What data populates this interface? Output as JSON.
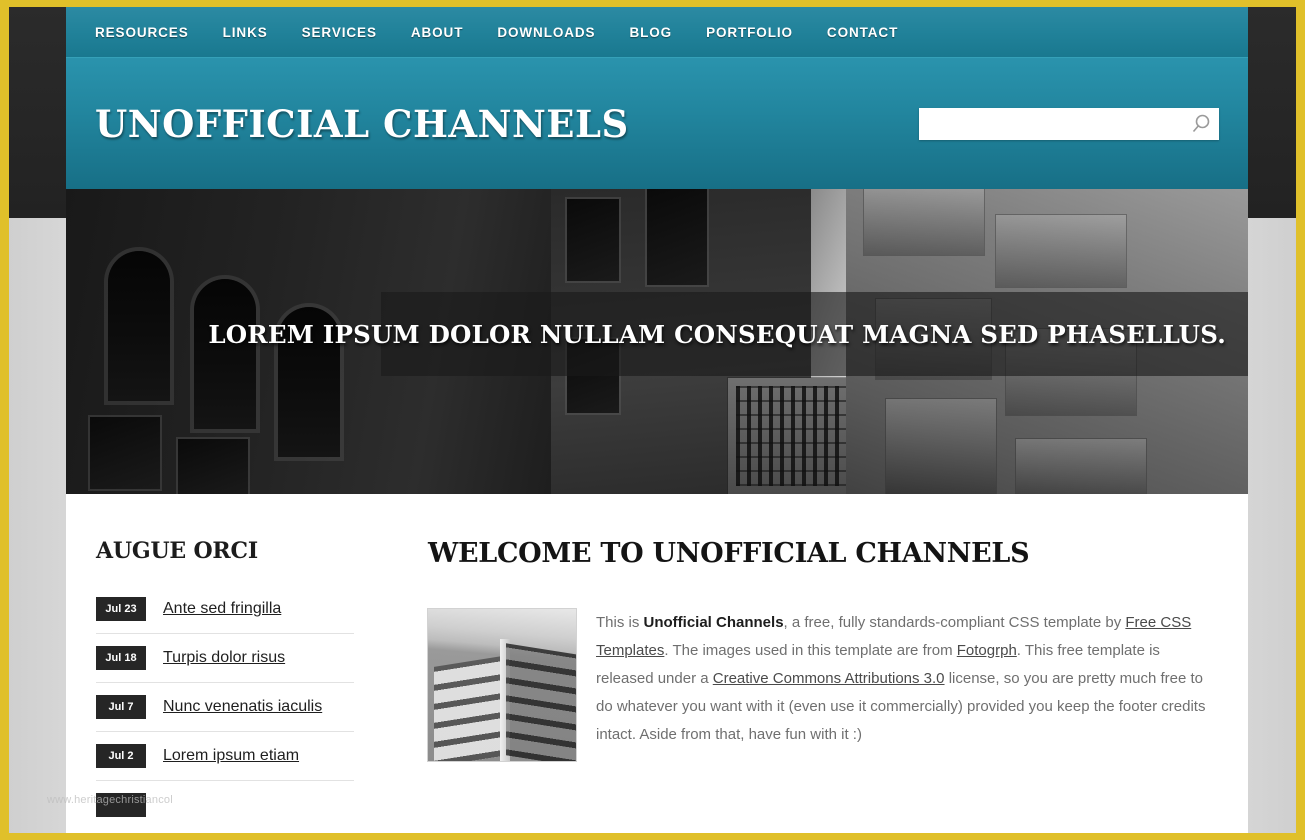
{
  "nav": {
    "items": [
      {
        "label": "RESOURCES"
      },
      {
        "label": "LINKS"
      },
      {
        "label": "SERVICES"
      },
      {
        "label": "ABOUT"
      },
      {
        "label": "DOWNLOADS"
      },
      {
        "label": "BLOG"
      },
      {
        "label": "PORTFOLIO"
      },
      {
        "label": "CONTACT"
      }
    ]
  },
  "header": {
    "logo": "UNOFFICIAL CHANNELS",
    "search": {
      "value": "",
      "placeholder": ""
    }
  },
  "hero": {
    "caption": "LOREM IPSUM DOLOR NULLAM CONSEQUAT MAGNA SED PHASELLUS."
  },
  "sidebar": {
    "title": "AUGUE ORCI",
    "news": [
      {
        "date": "Jul 23",
        "title": "Ante sed fringilla"
      },
      {
        "date": "Jul 18",
        "title": "Turpis dolor risus"
      },
      {
        "date": "Jul 7",
        "title": "Nunc venenatis iaculis"
      },
      {
        "date": "Jul 2",
        "title": "Lorem ipsum etiam"
      }
    ]
  },
  "main": {
    "title": "WELCOME TO UNOFFICIAL CHANNELS",
    "paragraph": {
      "p1": "This is ",
      "brand": "Unofficial Channels",
      "p2": ", a free, fully standards-compliant CSS template by ",
      "link1": "Free CSS Templates",
      "p3": ". The images used in this template are from ",
      "link2": "Fotogrph",
      "p4": ". This free template is released under a ",
      "link3": "Creative Commons Attributions 3.0",
      "p5": " license, so you are pretty much free to do whatever you want with it (even use it commercially) provided you keep the footer credits intact. Aside from that, have fun with it :)"
    }
  },
  "watermark": {
    "text": "www.heritagechristiancol"
  },
  "colors": {
    "frame_gold": "#e0c02a",
    "nav_teal": "#22839b",
    "header_teal": "#22869f",
    "dark_band": "#262626",
    "date_badge": "#262626",
    "body_text": "#6f6f6f"
  }
}
